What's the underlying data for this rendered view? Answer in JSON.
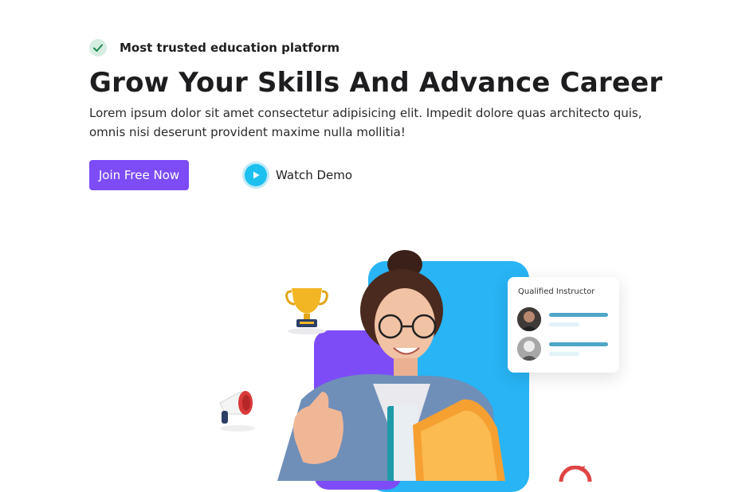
{
  "hero": {
    "badge_text": "Most trusted education platform",
    "title": "Grow Your Skills And Advance Career",
    "description": "Lorem ipsum dolor sit amet consectetur adipisicing elit. Impedit dolore quas architecto quis, omnis nisi deserunt provident maxime nulla mollitia!",
    "primary_button": "Join Free Now",
    "secondary_button": "Watch Demo"
  },
  "instructor_card": {
    "title": "Qualified Instructor"
  },
  "colors": {
    "accent_purple": "#7d4cf7",
    "accent_blue": "#28b4f5",
    "play_blue": "#1cc0ef",
    "check_green": "#1f8a55"
  },
  "icons": [
    "check-icon",
    "play-icon",
    "trophy-icon",
    "megaphone-icon",
    "target-icon"
  ]
}
